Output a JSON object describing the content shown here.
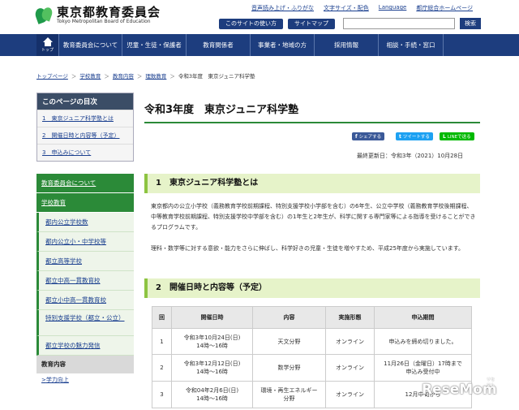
{
  "header": {
    "logo_jp": "東京都教育委員会",
    "logo_en": "Tokyo Metropolitan Board of Education",
    "util_links": [
      "音声読み上げ・ふりがな",
      "文字サイズ・配色",
      "Language",
      "都庁総合ホームページ"
    ],
    "util_buttons": [
      "このサイトの使い方",
      "サイトマップ"
    ],
    "search_button": "検索",
    "search_value": ""
  },
  "nav": {
    "home": "トップ",
    "items": [
      "教育委員会について",
      "児童・生徒・保護者",
      "教育関係者",
      "事業者・地域の方",
      "採用情報",
      "相談・手続・窓口"
    ]
  },
  "breadcrumb": [
    "トップページ",
    "学校教育",
    "教育内容",
    "理数教育",
    "令和3年度　東京ジュニア科学塾"
  ],
  "toc": {
    "heading": "このページの目次",
    "items": [
      "1　東京ジュニア科学塾とは",
      "2　開催日時と内容等（予定）",
      "3　申込みについて"
    ]
  },
  "sidebar": {
    "top": [
      "教育委員会について",
      "学校教育"
    ],
    "sub": [
      "都内公立学校数",
      "都内公立小・中学校等",
      "都立高等学校",
      "都立中高一貫教育校",
      "都立小中高一貫教育校",
      "特別支援学校（都立・公立）",
      "都立学校の魅力発信"
    ],
    "section": "教育内容",
    "current": "学力向上"
  },
  "page": {
    "title": "令和3年度　東京ジュニア科学塾",
    "share": [
      {
        "icon": "f",
        "label": "シェアする"
      },
      {
        "icon": "t",
        "label": "ツイートする"
      },
      {
        "icon": "L",
        "label": "LINEで送る"
      }
    ],
    "updated": "最終更新日：令和3年（2021）10月28日"
  },
  "section1": {
    "heading": "1　東京ジュニア科学塾とは",
    "para1": "東京都内の公立小学校（義務教育学校前期課程、特別支援学校小学部を含む）の6年生、公立中学校（義務教育学校後期課程、中等教育学校前期課程、特別支援学校中学部を含む）の1年生と2年生が、科学に関する専門家等による指導を受けることができるプログラムです。",
    "para2": "理科・数学等に対する意欲・能力をさらに伸ばし、科学好きの児童・生徒を増やすため、平成25年度から実施しています。"
  },
  "section2": {
    "heading": "2　開催日時と内容等（予定）",
    "columns": [
      "回",
      "開催日時",
      "内容",
      "実施形態",
      "申込期間"
    ],
    "rows": [
      {
        "no": "1",
        "date": "令和3年10月24日(日)",
        "time": "14時～16時",
        "content": "天文分野",
        "content2": "",
        "mode": "オンライン",
        "period": "申込みを締め切りました。",
        "period2": ""
      },
      {
        "no": "2",
        "date": "令和3年12月12日(日)",
        "time": "14時～16時",
        "content": "数学分野",
        "content2": "",
        "mode": "オンライン",
        "period": "11月26日（金曜日）17時まで",
        "period2": "申込み受付中"
      },
      {
        "no": "3",
        "date": "令和04年2月6日(日)",
        "time": "14時～16時",
        "content": "環境・再生エネルギー",
        "content2": "分野",
        "mode": "オンライン",
        "period": "12月中旬から",
        "period2": ""
      }
    ]
  },
  "watermark": {
    "text": "ReseMom",
    "sub": "リセマム"
  },
  "colors": {
    "navy": "#1d3d7e",
    "green": "#2b8a38",
    "lime": "#8dc441"
  }
}
